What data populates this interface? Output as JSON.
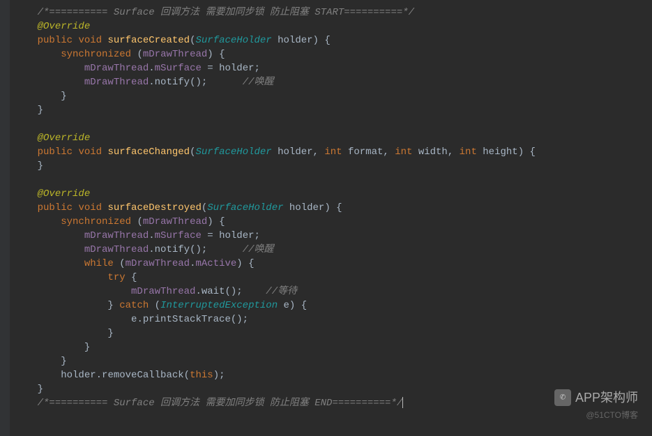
{
  "code": {
    "comment_start": "/*========== Surface 回调方法 需要加同步锁 防止阻塞 START==========*/",
    "override": "Override",
    "at": "@",
    "kw_public": "public",
    "kw_void": "void",
    "kw_synchronized": "synchronized",
    "kw_int": "int",
    "kw_while": "while",
    "kw_try": "try",
    "kw_catch": "catch",
    "kw_this": "this",
    "type_surfaceholder": "SurfaceHolder",
    "type_interrupted": "InterruptedException",
    "m_surfaceCreated": "surfaceCreated",
    "m_surfaceChanged": "surfaceChanged",
    "m_surfaceDestroyed": "surfaceDestroyed",
    "m_notify": "notify",
    "m_wait": "wait",
    "m_printStackTrace": "printStackTrace",
    "m_removeCallback": "removeCallback",
    "f_mDrawThread": "mDrawThread",
    "f_mSurface": "mSurface",
    "f_mActive": "mActive",
    "p_holder": "holder",
    "p_format": "format",
    "p_width": "width",
    "p_height": "height",
    "p_e": "e",
    "comment_wake": "//唤醒",
    "comment_wait": "//等待",
    "comment_end": "/*========== Surface 回调方法 需要加同步锁 防止阻塞 END==========*/"
  },
  "watermark": {
    "main": "APP架构师",
    "sub": "@51CTO博客"
  }
}
